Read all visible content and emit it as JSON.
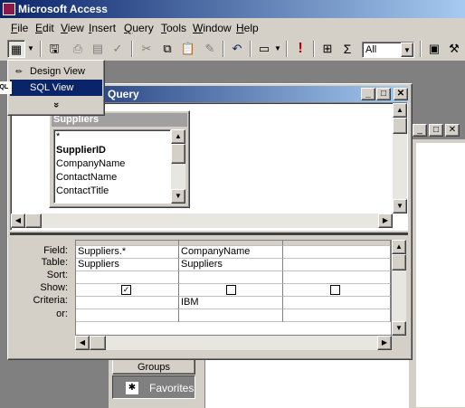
{
  "app": {
    "title": "Microsoft Access"
  },
  "menu": [
    "File",
    "Edit",
    "View",
    "Insert",
    "Query",
    "Tools",
    "Window",
    "Help"
  ],
  "menu_underline": [
    "F",
    "E",
    "V",
    "I",
    "Q",
    "T",
    "W",
    "H"
  ],
  "toolbar": {
    "combo_value": "All",
    "run_icon": "!",
    "totals_icon": "Σ"
  },
  "view_dropdown": {
    "items": [
      {
        "label": "Design View",
        "selected": false,
        "icon": "design-view-icon"
      },
      {
        "label": "SQL View",
        "selected": true,
        "icon": "sql-view-icon",
        "glyph": "SQL"
      }
    ],
    "more": "»"
  },
  "query_window": {
    "title": "Query",
    "table": {
      "name": "Suppliers",
      "fields": [
        "*",
        "SupplierID",
        "CompanyName",
        "ContactName",
        "ContactTitle"
      ],
      "bold_field": "SupplierID"
    },
    "grid": {
      "row_labels": [
        "Field:",
        "Table:",
        "Sort:",
        "Show:",
        "Criteria:",
        "or:"
      ],
      "columns": [
        {
          "field": "Suppliers.*",
          "table": "Suppliers",
          "sort": "",
          "show": true,
          "criteria": "",
          "or": ""
        },
        {
          "field": "CompanyName",
          "table": "Suppliers",
          "sort": "",
          "show": false,
          "criteria": "IBM",
          "or": ""
        },
        {
          "field": "",
          "table": "",
          "sort": "",
          "show": false,
          "criteria": "",
          "or": ""
        }
      ]
    }
  },
  "db_window": {
    "groups_label": "Groups",
    "favorites_label": "Favorites"
  },
  "colors": {
    "title_start": "#0a246a",
    "title_end": "#a6caf0",
    "face": "#d4d0c8"
  }
}
